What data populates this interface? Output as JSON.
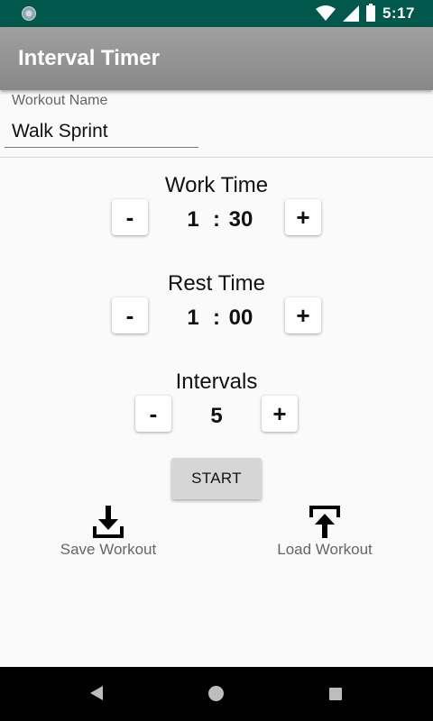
{
  "status_bar": {
    "time": "5:17",
    "icons": [
      "notification-icon",
      "wifi-icon",
      "cell-signal-icon",
      "battery-icon"
    ]
  },
  "app_bar": {
    "title": "Interval Timer"
  },
  "workout_name": {
    "label": "Workout Name",
    "value": "Walk Sprint"
  },
  "work_time": {
    "title": "Work Time",
    "minus_label": "-",
    "plus_label": "+",
    "minutes": "1",
    "separator": ":",
    "seconds": "30"
  },
  "rest_time": {
    "title": "Rest Time",
    "minus_label": "-",
    "plus_label": "+",
    "minutes": "1",
    "separator": ":",
    "seconds": "00"
  },
  "intervals": {
    "title": "Intervals",
    "minus_label": "-",
    "plus_label": "+",
    "value": "5"
  },
  "start_button": {
    "label": "START"
  },
  "actions": {
    "save": {
      "label": "Save Workout",
      "icon": "download-icon"
    },
    "load": {
      "label": "Load Workout",
      "icon": "upload-icon"
    }
  },
  "nav_bar": {
    "icons": [
      "back-icon",
      "home-icon",
      "recents-icon"
    ]
  },
  "colors": {
    "status_bar": "#00574b",
    "app_bar": "#999999",
    "background": "#fafafa",
    "start_button": "#d6d6d6"
  }
}
